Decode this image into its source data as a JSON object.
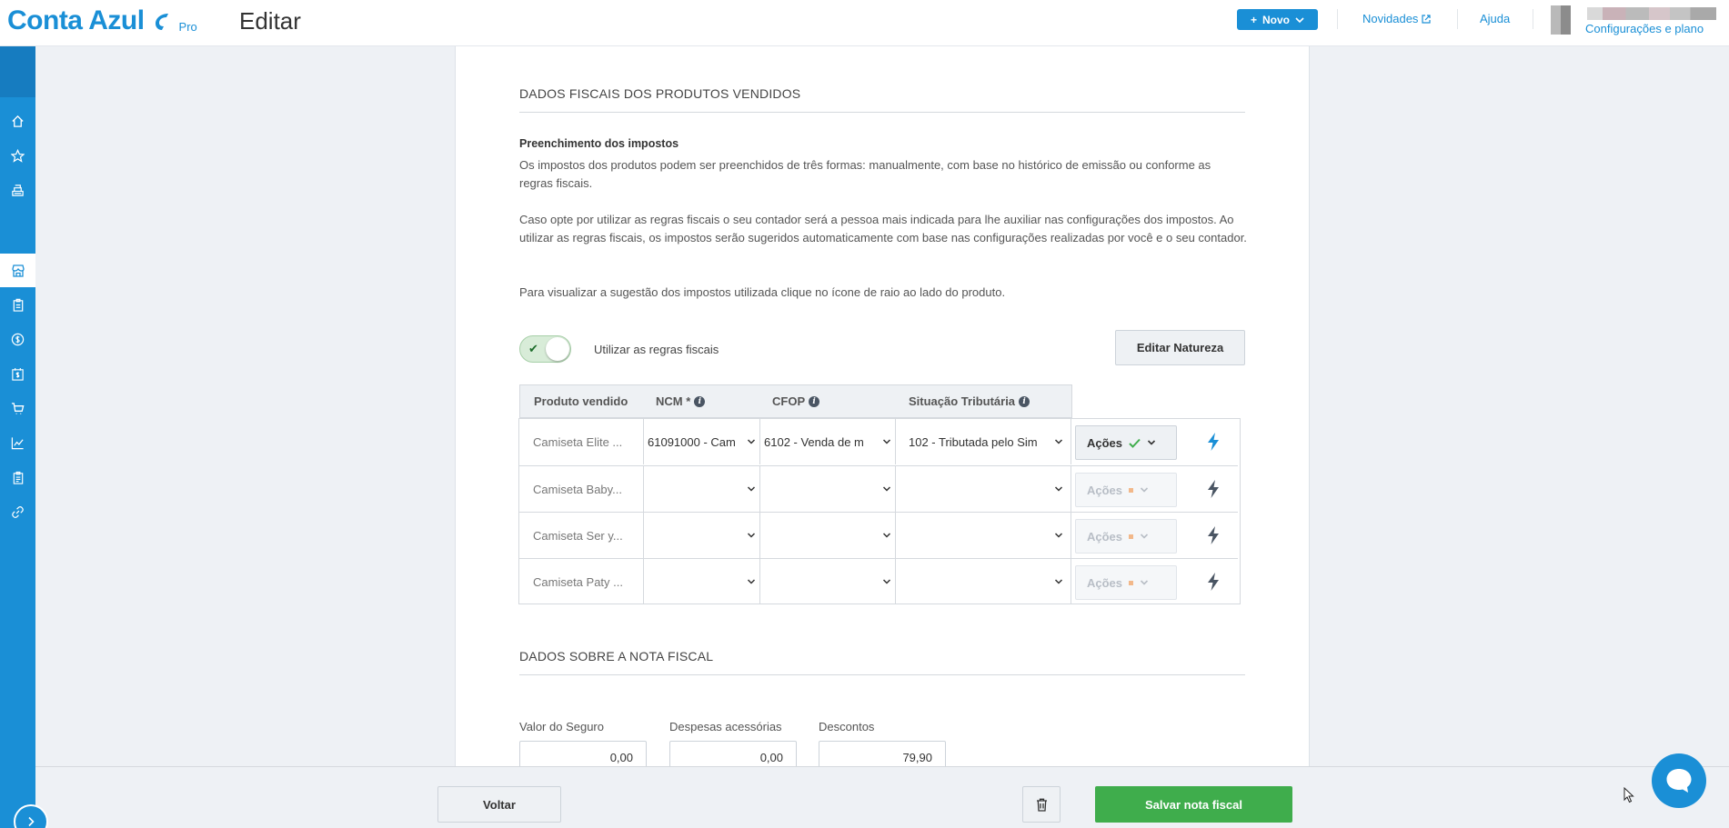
{
  "header": {
    "brand_name": "Conta Azul",
    "brand_plan": "Pro",
    "page_title": "Editar",
    "new_button": "Novo",
    "links": {
      "novidades": "Novidades",
      "ajuda": "Ajuda",
      "account": "Configurações e plano"
    }
  },
  "sidebar": {
    "items": [
      {
        "icon": "home-icon"
      },
      {
        "icon": "star-icon"
      },
      {
        "icon": "cash-register-icon"
      },
      {
        "icon": "store-icon",
        "active": true
      },
      {
        "icon": "clipboard-icon"
      },
      {
        "icon": "dollar-icon"
      },
      {
        "icon": "calendar-dollar-icon"
      },
      {
        "icon": "cart-icon"
      },
      {
        "icon": "chart-line-icon"
      },
      {
        "icon": "report-icon"
      },
      {
        "icon": "link-icon"
      }
    ]
  },
  "fiscal": {
    "section_title": "DADOS FISCAIS DOS PRODUTOS VENDIDOS",
    "subtitle": "Preenchimento dos impostos",
    "paragraph1": "Os impostos dos produtos podem ser preenchidos de três formas: manualmente, com base no histórico de emissão ou conforme as regras fiscais.",
    "paragraph2": "Caso opte por utilizar as regras fiscais o seu contador será a pessoa mais indicada para lhe auxiliar nas configurações dos impostos. Ao utilizar as regras fiscais, os impostos serão sugeridos automaticamente com base nas configurações realizadas por você e o seu contador.",
    "paragraph3": "Para visualizar a sugestão dos impostos utilizada clique no ícone de raio ao lado do produto.",
    "toggle_label": "Utilizar as regras fiscais",
    "toggle_on": true,
    "edit_nature_button": "Editar Natureza"
  },
  "table": {
    "headers": {
      "product": "Produto vendido",
      "ncm": "NCM *",
      "cfop": "CFOP",
      "situacao": "Situação Tributária"
    },
    "rows": [
      {
        "product": "Camiseta Elite ...",
        "ncm": "61091000 - Cam",
        "cfop": "6102 - Venda de m",
        "situacao": "102 - Tributada pelo Sim",
        "actions": "Ações",
        "status": "ok"
      },
      {
        "product": "Camiseta Baby...",
        "ncm": "",
        "cfop": "",
        "situacao": "",
        "actions": "Ações",
        "status": "pending"
      },
      {
        "product": "Camiseta Ser y...",
        "ncm": "",
        "cfop": "",
        "situacao": "",
        "actions": "Ações",
        "status": "pending"
      },
      {
        "product": "Camiseta Paty ...",
        "ncm": "",
        "cfop": "",
        "situacao": "",
        "actions": "Ações",
        "status": "pending"
      }
    ]
  },
  "nota": {
    "section_title": "DADOS SOBRE A NOTA FISCAL",
    "fields": [
      {
        "label": "Valor do Seguro",
        "value": "0,00"
      },
      {
        "label": "Despesas acessórias",
        "value": "0,00"
      },
      {
        "label": "Descontos",
        "value": "79,90"
      }
    ]
  },
  "footer": {
    "back_button": "Voltar",
    "save_button": "Salvar nota fiscal"
  },
  "colors": {
    "brand": "#1a8fd6",
    "success": "#3fad4c",
    "pending": "#f2b88a"
  }
}
